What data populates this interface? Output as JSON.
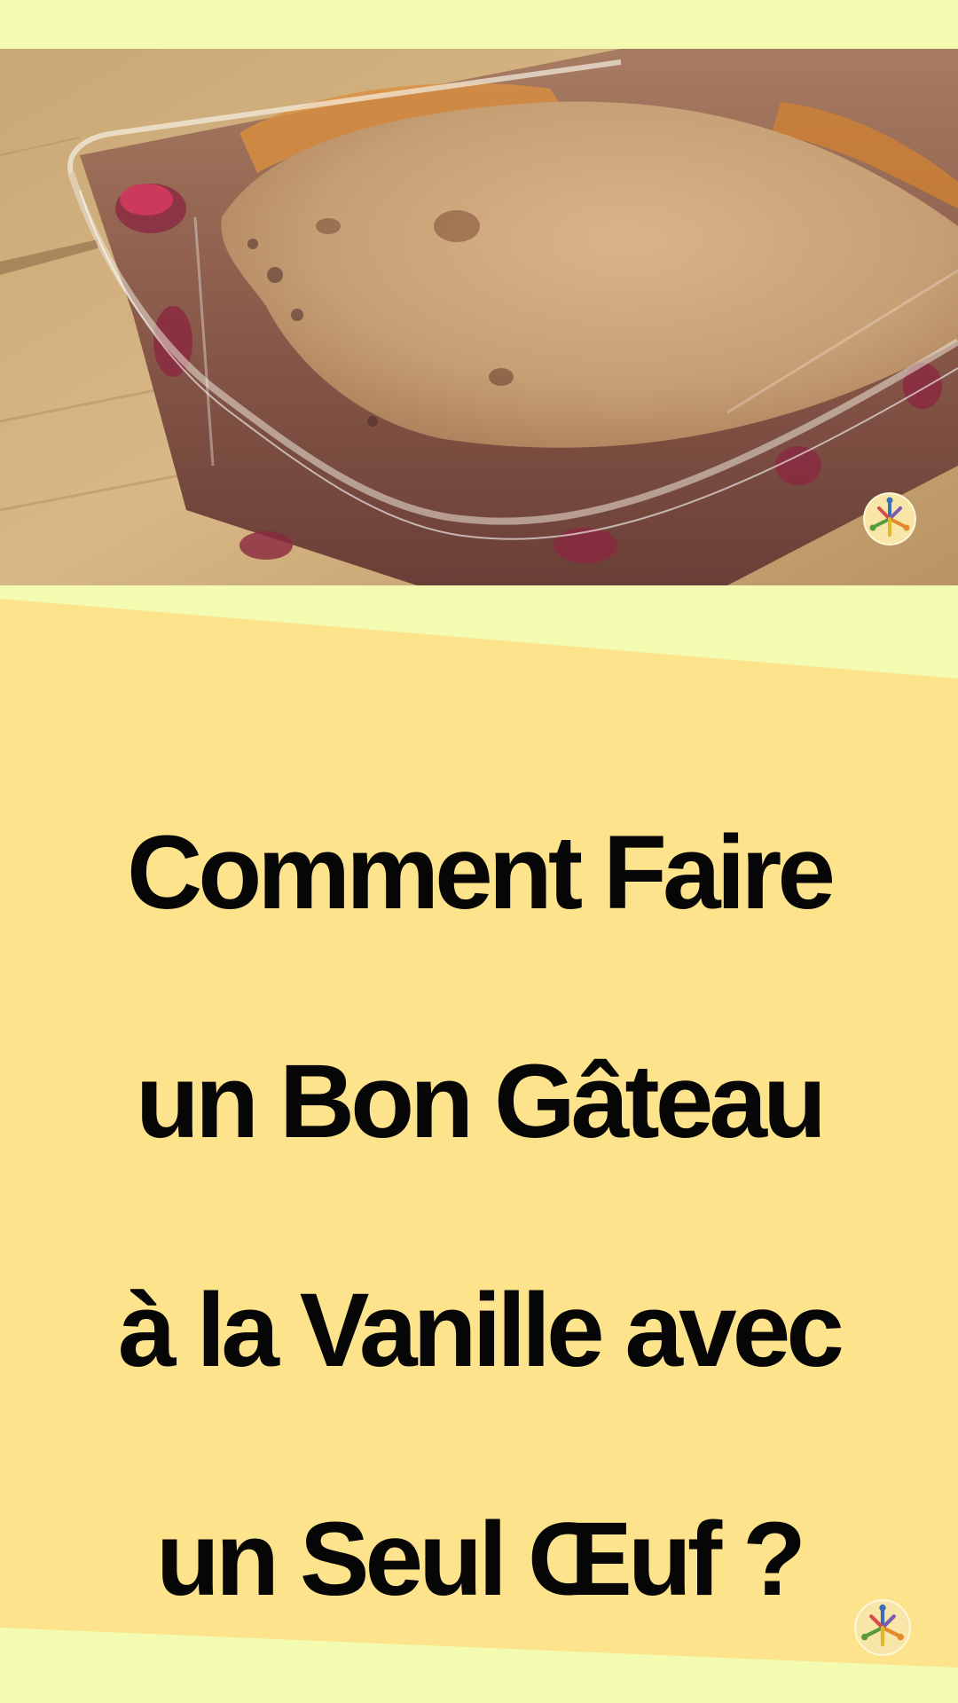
{
  "pin": {
    "title_lines": [
      "Comment Faire",
      "un Bon Gâteau",
      "à la Vanille avec",
      "un Seul Œuf ?"
    ],
    "image_subject": "vanilla-cake-in-glass-baking-dish",
    "logo_icon": "people-circle-logo-icon"
  },
  "colors": {
    "background": "#f2fbb0",
    "panel": "#fde38b",
    "text": "#060606"
  }
}
